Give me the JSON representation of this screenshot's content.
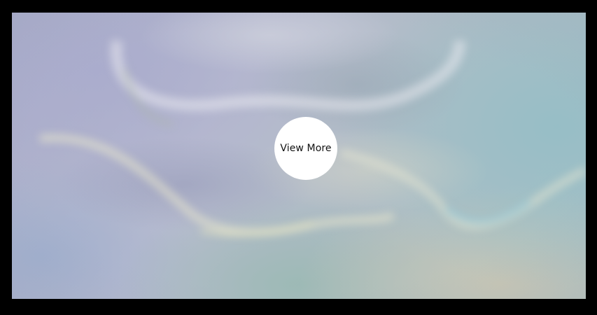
{
  "view_more": {
    "label": "View More"
  },
  "colors": {
    "frame": "#000000",
    "button_bg": "#ffffff",
    "button_text": "#111111",
    "gradient_lavender": "#a9acc8",
    "gradient_teal": "#a7c2c6",
    "gradient_cream": "#c8c6b4"
  }
}
